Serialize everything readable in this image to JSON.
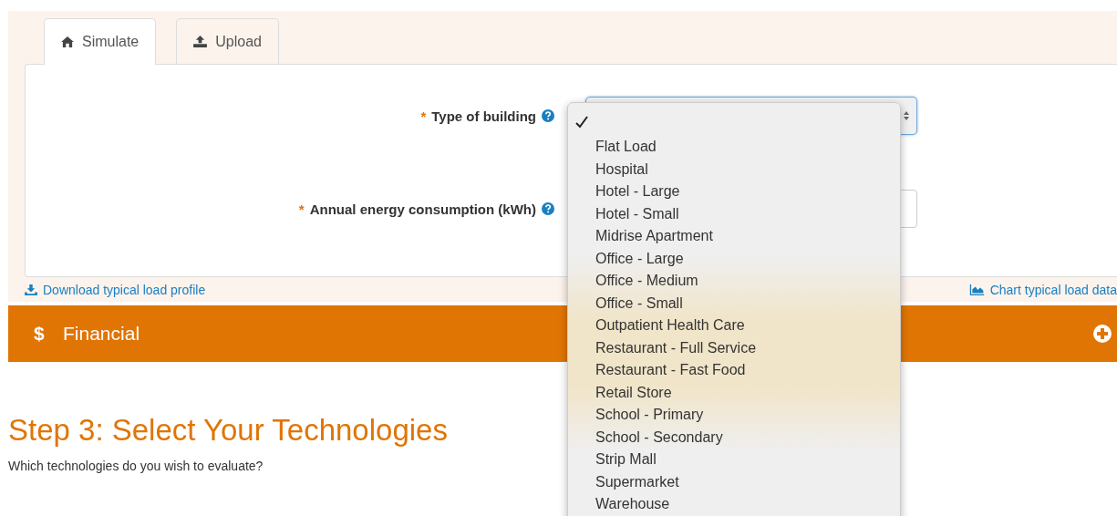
{
  "tabs": [
    {
      "label": "Simulate",
      "selected": true
    },
    {
      "label": "Upload",
      "selected": false
    }
  ],
  "form": {
    "fields": [
      {
        "label": "Type of building",
        "required": true,
        "kind": "select"
      },
      {
        "label": "Annual energy consumption (kWh)",
        "required": true,
        "kind": "input"
      }
    ],
    "required_mark": "*"
  },
  "links": {
    "download": "Download typical load profile",
    "chart": "Chart typical load data"
  },
  "financial": {
    "icon": "$",
    "title": "Financial",
    "expanded": false
  },
  "step": {
    "title": "Step 3: Select Your Technologies",
    "question": "Which technologies do you wish to evaluate?"
  },
  "dropdown": {
    "options": [
      {
        "selected": true
      },
      {
        "label": "Flat Load",
        "selected": false
      },
      {
        "label": "Hospital",
        "selected": false
      },
      {
        "label": "Hotel - Large",
        "selected": false
      },
      {
        "label": "Hotel - Small",
        "selected": false
      },
      {
        "label": "Midrise Apartment",
        "selected": false
      },
      {
        "label": "Office - Large",
        "selected": false
      },
      {
        "label": "Office - Medium",
        "selected": false
      },
      {
        "label": "Office - Small",
        "selected": false
      },
      {
        "label": "Outpatient Health Care",
        "selected": false
      },
      {
        "label": "Restaurant - Full Service",
        "selected": false
      },
      {
        "label": "Restaurant - Fast Food",
        "selected": false
      },
      {
        "label": "Retail Store",
        "selected": false
      },
      {
        "label": "School - Primary",
        "selected": false
      },
      {
        "label": "School - Secondary",
        "selected": false
      },
      {
        "label": "Strip Mall",
        "selected": false
      },
      {
        "label": "Supermarket",
        "selected": false
      },
      {
        "label": "Warehouse",
        "selected": false
      }
    ]
  }
}
